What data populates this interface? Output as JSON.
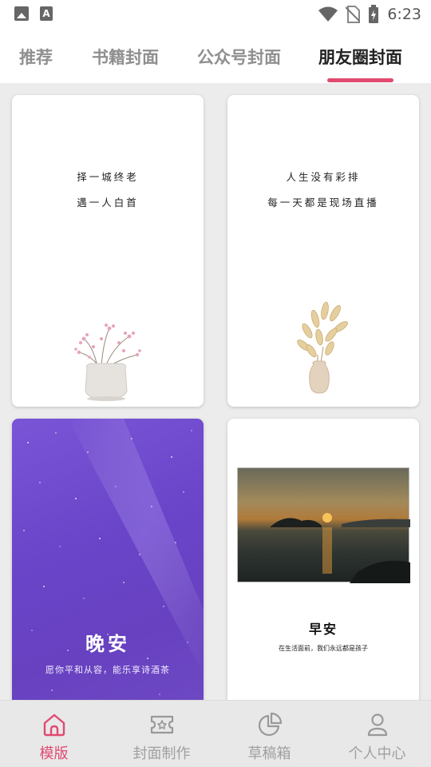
{
  "status_bar": {
    "time": "6:23"
  },
  "tabs": [
    {
      "label": "推荐",
      "active": false
    },
    {
      "label": "书籍封面",
      "active": false
    },
    {
      "label": "公众号封面",
      "active": false
    },
    {
      "label": "朋友圈封面",
      "active": true
    }
  ],
  "templates": [
    {
      "lines": [
        "择一城终老",
        "遇一人白首"
      ],
      "decor": "pink-flower-vase"
    },
    {
      "lines": [
        "人生没有彩排",
        "每一天都是现场直播"
      ],
      "decor": "dried-grass-vase"
    },
    {
      "title": "晚安",
      "subtitle": "愿你平和从容，能乐享诗酒茶",
      "background": "starry-purple-sky"
    },
    {
      "title": "早安",
      "subtitle": "在生活面前，我们永远都是孩子",
      "photo": "sunset-over-sea"
    }
  ],
  "bottom_nav": [
    {
      "label": "模版",
      "icon": "home-icon",
      "active": true
    },
    {
      "label": "封面制作",
      "icon": "ticket-star-icon",
      "active": false
    },
    {
      "label": "草稿箱",
      "icon": "pie-chart-icon",
      "active": false
    },
    {
      "label": "个人中心",
      "icon": "user-icon",
      "active": false
    }
  ],
  "colors": {
    "accent": "#e04a71",
    "inactive": "#a0a0a0",
    "night_bg": "#6a45c9"
  }
}
